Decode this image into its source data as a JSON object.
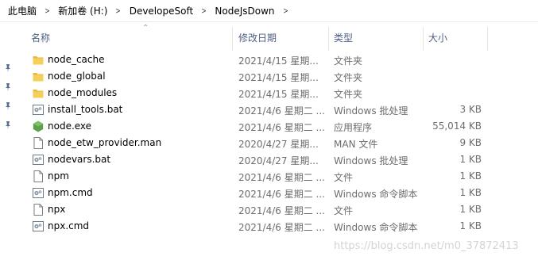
{
  "breadcrumb": [
    "此电脑",
    "新加卷 (H:)",
    "DevelopeSoft",
    "NodeJsDown"
  ],
  "columns": {
    "name": "名称",
    "date": "修改日期",
    "type": "类型",
    "size": "大小"
  },
  "files": [
    {
      "name": "node_cache",
      "date": "2021/4/15 星期...",
      "type": "文件夹",
      "size": "",
      "icon": "folder-icon"
    },
    {
      "name": "node_global",
      "date": "2021/4/15 星期...",
      "type": "文件夹",
      "size": "",
      "icon": "folder-icon"
    },
    {
      "name": "node_modules",
      "date": "2021/4/15 星期...",
      "type": "文件夹",
      "size": "",
      "icon": "folder-icon"
    },
    {
      "name": "install_tools.bat",
      "date": "2021/4/6 星期二 ...",
      "type": "Windows 批处理",
      "size": "3 KB",
      "icon": "batch-file-icon"
    },
    {
      "name": "node.exe",
      "date": "2021/4/6 星期二 ...",
      "type": "应用程序",
      "size": "55,014 KB",
      "icon": "nodejs-exe-icon"
    },
    {
      "name": "node_etw_provider.man",
      "date": "2020/4/27 星期...",
      "type": "MAN 文件",
      "size": "9 KB",
      "icon": "file-icon"
    },
    {
      "name": "nodevars.bat",
      "date": "2020/4/27 星期...",
      "type": "Windows 批处理",
      "size": "1 KB",
      "icon": "batch-file-icon"
    },
    {
      "name": "npm",
      "date": "2021/4/6 星期二 ...",
      "type": "文件",
      "size": "1 KB",
      "icon": "file-icon"
    },
    {
      "name": "npm.cmd",
      "date": "2021/4/6 星期二 ...",
      "type": "Windows 命令脚本",
      "size": "1 KB",
      "icon": "cmd-file-icon"
    },
    {
      "name": "npx",
      "date": "2021/4/6 星期二 ...",
      "type": "文件",
      "size": "1 KB",
      "icon": "file-icon"
    },
    {
      "name": "npx.cmd",
      "date": "2021/4/6 星期二 ...",
      "type": "Windows 命令脚本",
      "size": "1 KB",
      "icon": "cmd-file-icon"
    }
  ],
  "pinned_count": 4,
  "watermark": "https://blog.csdn.net/m0_37872413",
  "colors": {
    "folder": "#f6cf5a",
    "header_text": "#4d6182",
    "node_green": "#5fa04e"
  }
}
